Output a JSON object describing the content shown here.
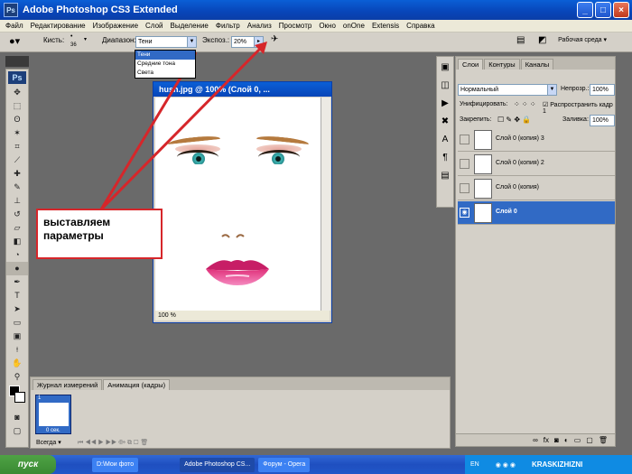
{
  "window": {
    "title": "Adobe Photoshop CS3 Extended",
    "logo": "Ps"
  },
  "menu": [
    "Файл",
    "Редактирование",
    "Изображение",
    "Слой",
    "Выделение",
    "Фильтр",
    "Анализ",
    "Просмотр",
    "Окно",
    "onOne",
    "Extensis",
    "Справка"
  ],
  "options": {
    "brush_label": "Кисть:",
    "brush_size": "36",
    "range_label": "Диапазон:",
    "range_value": "Тени",
    "range_options": [
      "Тени",
      "Средние тона",
      "Света"
    ],
    "exposure_label": "Экспоз.:",
    "exposure_value": "20%",
    "workspace": "Рабочая среда ▾"
  },
  "document": {
    "title": "hush.jpg @ 100% (Слой 0, ...",
    "zoom": "100 %"
  },
  "callout": {
    "line1": "выставляем",
    "line2": "параметры"
  },
  "layers_panel": {
    "tabs": [
      "Слои",
      "Контуры",
      "Каналы"
    ],
    "blend_mode": "Нормальный",
    "opacity_label": "Непрозр.:",
    "opacity_value": "100%",
    "unify_label": "Унифицировать:",
    "propagate_label": "Распространить кадр 1",
    "lock_label": "Закрепить:",
    "fill_label": "Заливка:",
    "fill_value": "100%",
    "layers": [
      {
        "name": "Слой 0 (копия) 3",
        "visible": false,
        "selected": false
      },
      {
        "name": "Слой 0 (копия) 2",
        "visible": false,
        "selected": false
      },
      {
        "name": "Слой 0 (копия)",
        "visible": false,
        "selected": false
      },
      {
        "name": "Слой 0",
        "visible": true,
        "selected": true
      }
    ]
  },
  "bottom_panel": {
    "tabs": [
      "Журнал измерений",
      "Анимация (кадры)"
    ],
    "frame_number": "1",
    "frame_time": "0 сек.",
    "loop": "Всегда"
  },
  "taskbar": {
    "start": "пуск",
    "tasks": [
      "D:\\Мои фото",
      "Adobe Photoshop CS...",
      "Форум - Opera"
    ],
    "lang": "EN",
    "brand": "KRASKIZHIZNI"
  },
  "colors": {
    "titlebar": "#0845b8",
    "selection": "#316ac5",
    "callout_border": "#d6262a",
    "arrow": "#d6262a"
  }
}
